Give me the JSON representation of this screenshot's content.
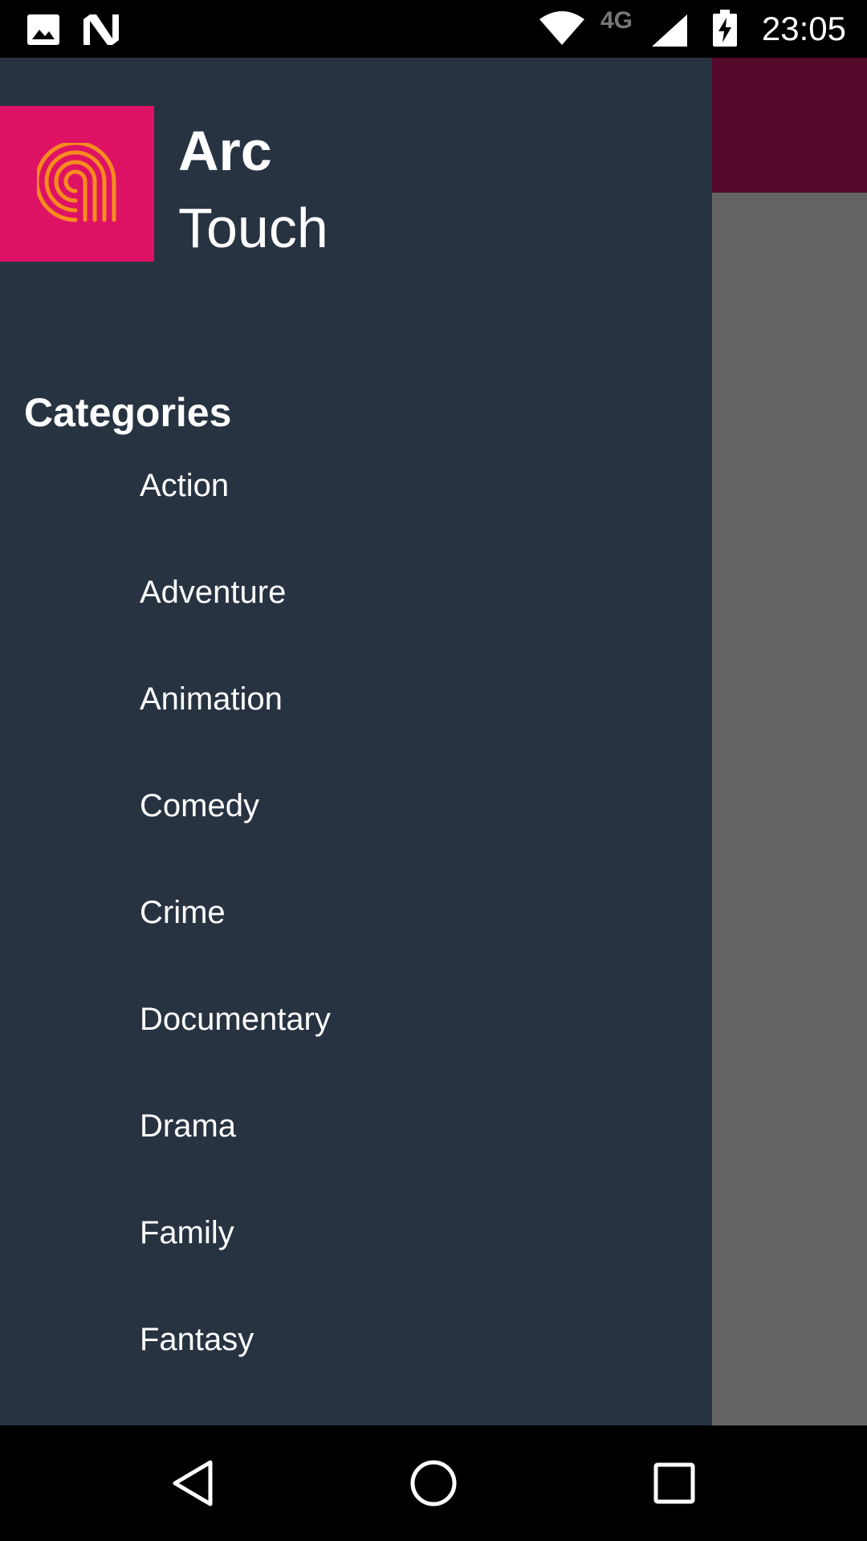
{
  "status_bar": {
    "time": "23:05",
    "network_label": "4G",
    "icons": [
      "image-icon",
      "n-logo-icon",
      "wifi-icon",
      "cell-signal-icon",
      "battery-charging-icon"
    ]
  },
  "drawer": {
    "brand": {
      "line1": "Arc",
      "line2": "Touch",
      "logo_color": "#de1264",
      "logo_stroke_color": "#f68b1f"
    },
    "section_title": "Categories",
    "categories": [
      {
        "label": "Action"
      },
      {
        "label": "Adventure"
      },
      {
        "label": "Animation"
      },
      {
        "label": "Comedy"
      },
      {
        "label": "Crime"
      },
      {
        "label": "Documentary"
      },
      {
        "label": "Drama"
      },
      {
        "label": "Family"
      },
      {
        "label": "Fantasy"
      }
    ],
    "background_color": "#283342"
  },
  "app_behind": {
    "toolbar_color": "#56082a",
    "scrim_color": "#646464"
  },
  "nav_bar": {
    "buttons": [
      "back-icon",
      "home-icon",
      "recents-icon"
    ]
  }
}
